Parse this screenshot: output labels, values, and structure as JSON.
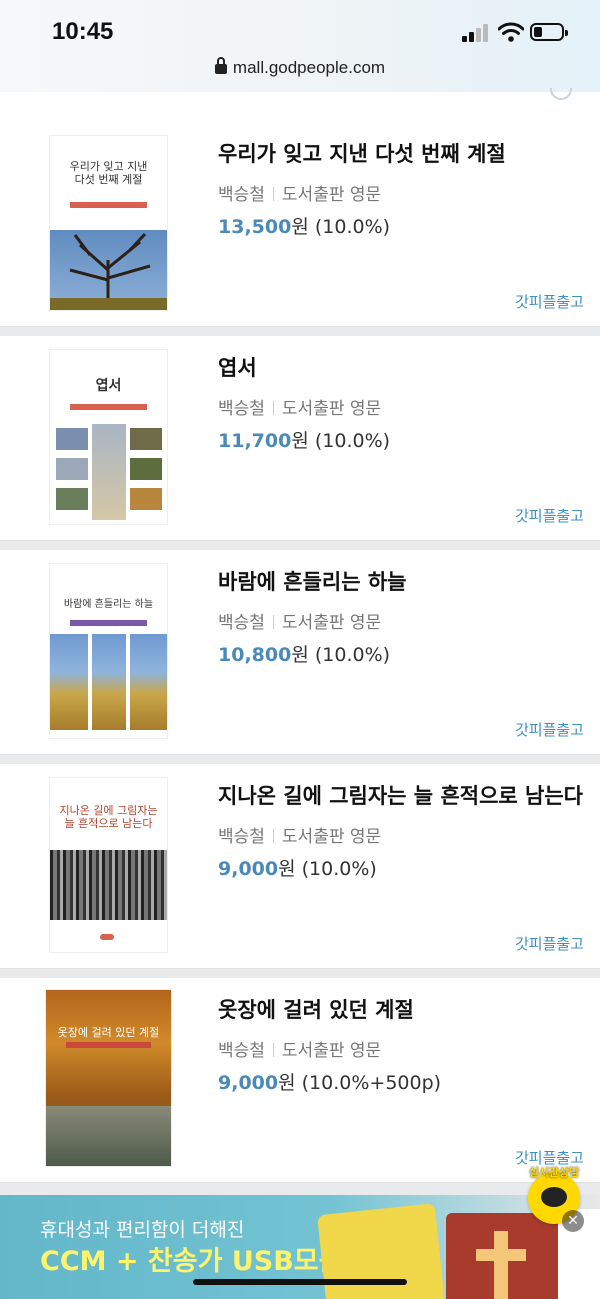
{
  "status": {
    "time": "10:45"
  },
  "browser": {
    "url": "mall.godpeople.com"
  },
  "products": [
    {
      "title": "우리가 잊고 지낸 다섯 번째 계절",
      "author": "백승철",
      "publisher": "도서출판 영문",
      "price": "13,500",
      "currency": "원",
      "discount": "(10.0%)",
      "shipping": "갓피플출고",
      "cover": {
        "text": "우리가 잊고 지낸\n다섯 번째 계절",
        "bg": "#ffffff",
        "art": "#6a8fb8"
      }
    },
    {
      "title": "엽서",
      "author": "백승철",
      "publisher": "도서출판 영문",
      "price": "11,700",
      "currency": "원",
      "discount": "(10.0%)",
      "shipping": "갓피플출고",
      "cover": {
        "text": "엽서",
        "bg": "#ffffff",
        "art": "#8a9fb5"
      }
    },
    {
      "title": "바람에 흔들리는 하늘",
      "author": "백승철",
      "publisher": "도서출판 영문",
      "price": "10,800",
      "currency": "원",
      "discount": "(10.0%)",
      "shipping": "갓피플출고",
      "cover": {
        "text": "바람에 흔들리는 하늘",
        "bg": "#ffffff",
        "art": "#b08a3c"
      }
    },
    {
      "title": "지나온 길에 그림자는 늘 흔적으로 남는다",
      "author": "백승철",
      "publisher": "도서출판 영문",
      "price": "9,000",
      "currency": "원",
      "discount": "(10.0%)",
      "shipping": "갓피플출고",
      "cover": {
        "text": "지나온 길에 그림자는\n늘 흔적으로 남는다",
        "bg": "#ffffff",
        "art": "#3b3b3b"
      }
    },
    {
      "title": "옷장에 걸려 있던 계절",
      "author": "백승철",
      "publisher": "도서출판 영문",
      "price": "9,000",
      "currency": "원",
      "discount": "(10.0%+500p)",
      "shipping": "갓피플출고",
      "cover": {
        "text": "옷장에 걸려 있던 계절",
        "bg": "#b36a1e",
        "art": "#c98a2a"
      }
    }
  ],
  "banner": {
    "line1": "휴대성과 편리함이 더해진",
    "line2": "CCM + 찬송가 USB모음"
  },
  "chat": {
    "label": "실시간상담"
  },
  "colors": {
    "accent": "#4a8ab8",
    "shipping": "#3e8fc4",
    "banner": "#62b7c9"
  }
}
